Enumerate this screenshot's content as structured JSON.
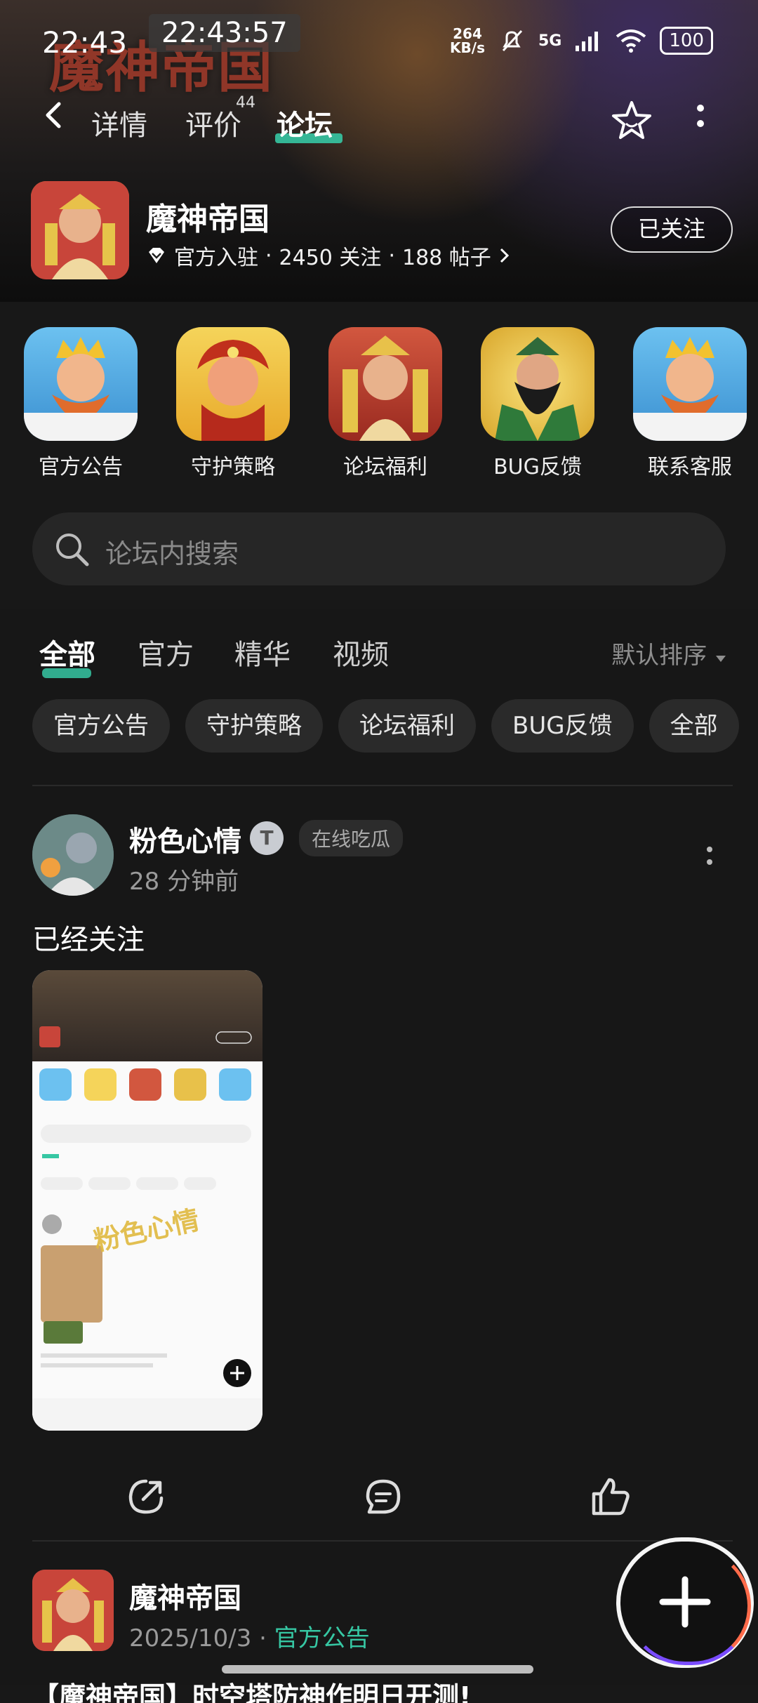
{
  "status_bar": {
    "time": "22:43",
    "time_overlay": "22:43:57",
    "net_speed_top": "264",
    "net_speed_bottom": "KB/s",
    "network": "5G",
    "battery": "100"
  },
  "nav": {
    "tabs": [
      {
        "label": "详情"
      },
      {
        "label": "评价",
        "count": "44"
      },
      {
        "label": "论坛"
      }
    ],
    "active_tab": "论坛"
  },
  "game": {
    "name": "魔神帝国",
    "logo_text": "魔神帝国",
    "verified_label": "官方入驻",
    "followers": "2450 关注",
    "posts": "188 帖子",
    "follow_button": "已关注"
  },
  "shortcuts": [
    {
      "label": "官方公告"
    },
    {
      "label": "守护策略"
    },
    {
      "label": "论坛福利"
    },
    {
      "label": "BUG反馈"
    },
    {
      "label": "联系客服"
    }
  ],
  "search": {
    "placeholder": "论坛内搜索"
  },
  "content_tabs": [
    {
      "label": "全部"
    },
    {
      "label": "官方"
    },
    {
      "label": "精华"
    },
    {
      "label": "视频"
    }
  ],
  "sort_label": "默认排序",
  "chips": [
    "官方公告",
    "守护策略",
    "论坛福利",
    "BUG反馈",
    "全部"
  ],
  "post1": {
    "author": "粉色心情",
    "badge": "T",
    "tag": "在线吃瓜",
    "time": "28 分钟前",
    "text": "已经关注",
    "watermark": "粉色心情"
  },
  "post2": {
    "author": "魔神帝国",
    "date": "2025/10/3",
    "category": "官方公告",
    "title": "【魔神帝国】时空塔防神作明日开测!"
  },
  "colors": {
    "accent": "#36c7a3",
    "background": "#181818"
  }
}
